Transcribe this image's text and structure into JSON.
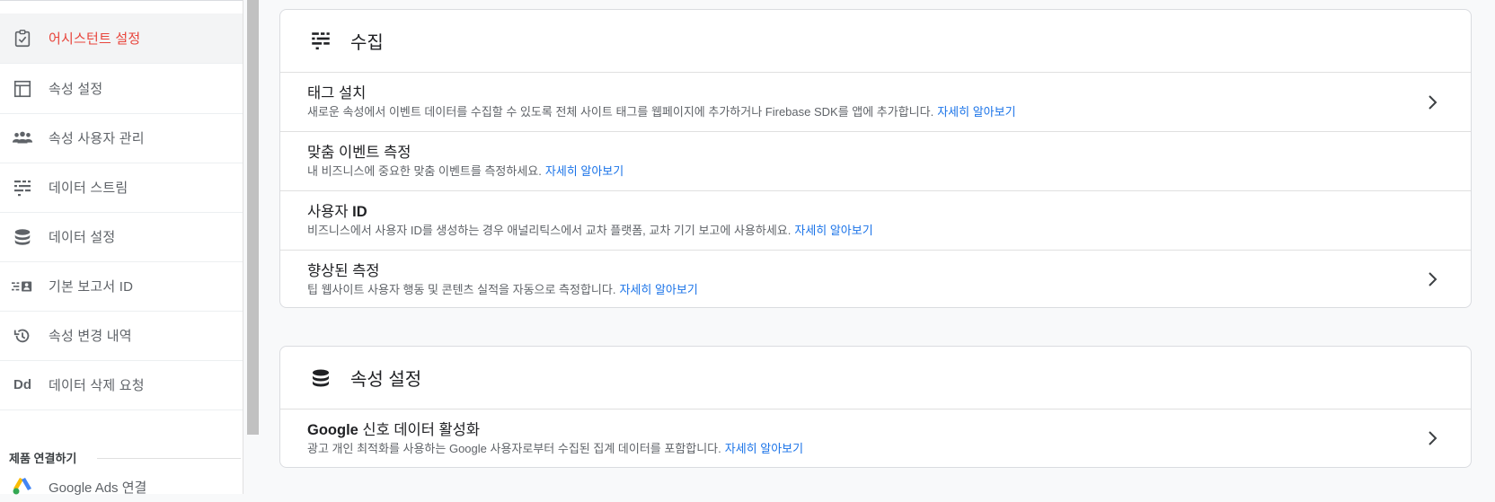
{
  "sidebar": {
    "items": [
      {
        "label": "어시스턴트 설정",
        "icon": "assignment-check-icon",
        "active": true
      },
      {
        "label": "속성 설정",
        "icon": "web-layout-icon"
      },
      {
        "label": "속성 사용자 관리",
        "icon": "people-icon"
      },
      {
        "label": "데이터 스트림",
        "icon": "data-streams-icon"
      },
      {
        "label": "데이터 설정",
        "icon": "database-icon"
      },
      {
        "label": "기본 보고서 ID",
        "icon": "report-id-icon"
      },
      {
        "label": "속성 변경 내역",
        "icon": "history-icon"
      },
      {
        "label": "데이터 삭제 요청",
        "icon": "dd-icon"
      }
    ],
    "section_label": "제품 연결하기",
    "partial_item": {
      "label": "Google Ads 연결",
      "icon": "google-ads-icon"
    },
    "dd_glyph": "Dd",
    "active_color": "#e8453c"
  },
  "main": {
    "cards": [
      {
        "title": "수집",
        "icon": "data-streams-icon",
        "rows": [
          {
            "title_pre": "태그 설치",
            "title_bold": "",
            "desc": "새로운 속성에서 이벤트 데이터를 수집할 수 있도록 전체 사이트 태그를 웹페이지에 추가하거나 Firebase SDK를 앱에 추가합니다.",
            "link": "자세히 알아보기",
            "chevron": true
          },
          {
            "title_pre": "맞춤 이벤트 측정",
            "title_bold": "",
            "desc": "내 비즈니스에 중요한 맞춤 이벤트를 측정하세요.",
            "link": "자세히 알아보기",
            "chevron": false
          },
          {
            "title_pre": "사용자 ",
            "title_bold": "ID",
            "desc": "비즈니스에서 사용자 ID를 생성하는 경우 애널리틱스에서 교차 플랫폼, 교차 기기 보고에 사용하세요.",
            "link": "자세히 알아보기",
            "chevron": false
          },
          {
            "title_pre": "향상된 측정",
            "title_bold": "",
            "desc": "팁 웹사이트 사용자 행동 및 콘텐츠 실적을 자동으로 측정합니다.",
            "link": "자세히 알아보기",
            "chevron": true
          }
        ]
      },
      {
        "title": "속성 설정",
        "icon": "database-icon",
        "rows": [
          {
            "title_bold": "Google",
            "title_post": " 신호 데이터 활성화",
            "desc": "광고 개인 최적화를 사용하는 Google 사용자로부터 수집된 집계 데이터를 포함합니다.",
            "link": "자세히 알아보기",
            "chevron": true
          }
        ]
      }
    ]
  },
  "colors": {
    "link": "#1a73e8",
    "active": "#e8453c"
  }
}
